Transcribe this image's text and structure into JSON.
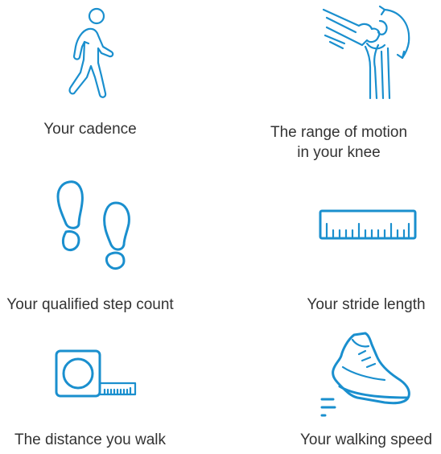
{
  "accent_color": "#1a8fce",
  "text_color": "#333333",
  "items": [
    {
      "label": "Your cadence",
      "icon": "walking-person-icon"
    },
    {
      "label": "The range of motion in your knee",
      "icon": "knee-joint-icon"
    },
    {
      "label": "Your qualified step count",
      "icon": "footprints-icon"
    },
    {
      "label": "Your stride length",
      "icon": "ruler-icon"
    },
    {
      "label": "The distance you walk",
      "icon": "tape-measure-icon"
    },
    {
      "label": "Your walking speed",
      "icon": "running-shoe-icon"
    }
  ]
}
